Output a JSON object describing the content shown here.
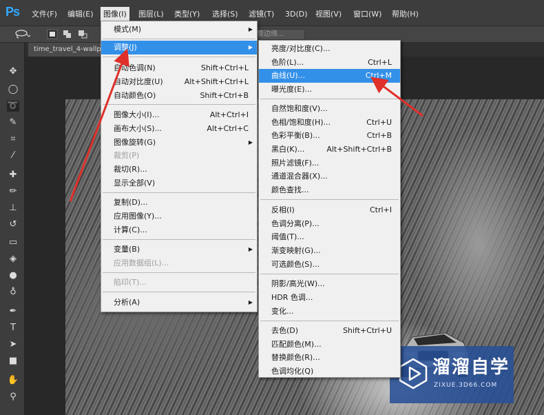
{
  "menubar": {
    "logo": "Ps",
    "items": [
      {
        "label": "文件(F)"
      },
      {
        "label": "编辑(E)"
      },
      {
        "label": "图像(I)"
      },
      {
        "label": "图层(L)"
      },
      {
        "label": "类型(Y)"
      },
      {
        "label": "选择(S)"
      },
      {
        "label": "滤镜(T)"
      },
      {
        "label": "3D(D)"
      },
      {
        "label": "视图(V)"
      },
      {
        "label": "窗口(W)"
      },
      {
        "label": "帮助(H)"
      }
    ]
  },
  "options_bar": {
    "refine_edge_label": "调整边缘..."
  },
  "document": {
    "tab_title": "time_travel_4-wallp"
  },
  "image_menu": {
    "items": [
      {
        "label": "模式(M)",
        "shortcut": "",
        "submenu": true
      },
      {
        "label": "调整(J)",
        "shortcut": "",
        "submenu": true,
        "highlighted": true
      },
      {
        "label": "自动色调(N)",
        "shortcut": "Shift+Ctrl+L"
      },
      {
        "label": "自动对比度(U)",
        "shortcut": "Alt+Shift+Ctrl+L"
      },
      {
        "label": "自动颜色(O)",
        "shortcut": "Shift+Ctrl+B"
      },
      {
        "label": "图像大小(I)...",
        "shortcut": "Alt+Ctrl+I"
      },
      {
        "label": "画布大小(S)...",
        "shortcut": "Alt+Ctrl+C"
      },
      {
        "label": "图像旋转(G)",
        "shortcut": "",
        "submenu": true
      },
      {
        "label": "裁剪(P)",
        "shortcut": "",
        "disabled": true
      },
      {
        "label": "裁切(R)...",
        "shortcut": ""
      },
      {
        "label": "显示全部(V)",
        "shortcut": ""
      },
      {
        "label": "复制(D)...",
        "shortcut": ""
      },
      {
        "label": "应用图像(Y)...",
        "shortcut": ""
      },
      {
        "label": "计算(C)...",
        "shortcut": ""
      },
      {
        "label": "变量(B)",
        "shortcut": "",
        "submenu": true
      },
      {
        "label": "应用数据组(L)...",
        "shortcut": "",
        "disabled": true
      },
      {
        "label": "陷印(T)...",
        "shortcut": "",
        "disabled": true
      },
      {
        "label": "分析(A)",
        "shortcut": "",
        "submenu": true
      }
    ]
  },
  "adjust_menu": {
    "items": [
      {
        "label": "亮度/对比度(C)...",
        "shortcut": ""
      },
      {
        "label": "色阶(L)...",
        "shortcut": "Ctrl+L"
      },
      {
        "label": "曲线(U)...",
        "shortcut": "Ctrl+M",
        "highlighted": true
      },
      {
        "label": "曝光度(E)...",
        "shortcut": ""
      },
      {
        "label": "自然饱和度(V)...",
        "shortcut": ""
      },
      {
        "label": "色相/饱和度(H)...",
        "shortcut": "Ctrl+U"
      },
      {
        "label": "色彩平衡(B)...",
        "shortcut": "Ctrl+B"
      },
      {
        "label": "黑白(K)...",
        "shortcut": "Alt+Shift+Ctrl+B"
      },
      {
        "label": "照片滤镜(F)...",
        "shortcut": ""
      },
      {
        "label": "通道混合器(X)...",
        "shortcut": ""
      },
      {
        "label": "颜色查找...",
        "shortcut": ""
      },
      {
        "label": "反相(I)",
        "shortcut": "Ctrl+I"
      },
      {
        "label": "色调分离(P)...",
        "shortcut": ""
      },
      {
        "label": "阈值(T)...",
        "shortcut": ""
      },
      {
        "label": "渐变映射(G)...",
        "shortcut": ""
      },
      {
        "label": "可选颜色(S)...",
        "shortcut": ""
      },
      {
        "label": "阴影/高光(W)...",
        "shortcut": ""
      },
      {
        "label": "HDR 色调...",
        "shortcut": ""
      },
      {
        "label": "变化...",
        "shortcut": ""
      },
      {
        "label": "去色(D)",
        "shortcut": "Shift+Ctrl+U"
      },
      {
        "label": "匹配颜色(M)...",
        "shortcut": ""
      },
      {
        "label": "替换颜色(R)...",
        "shortcut": ""
      },
      {
        "label": "色调均化(Q)",
        "shortcut": ""
      }
    ]
  },
  "watermark": {
    "title": "溜溜自学",
    "url": "ZIXUE.3D66.COM"
  },
  "colors": {
    "highlight": "#3390e8",
    "annotation_arrow": "#e0302a",
    "menubar_bg": "#3d3d3d"
  }
}
